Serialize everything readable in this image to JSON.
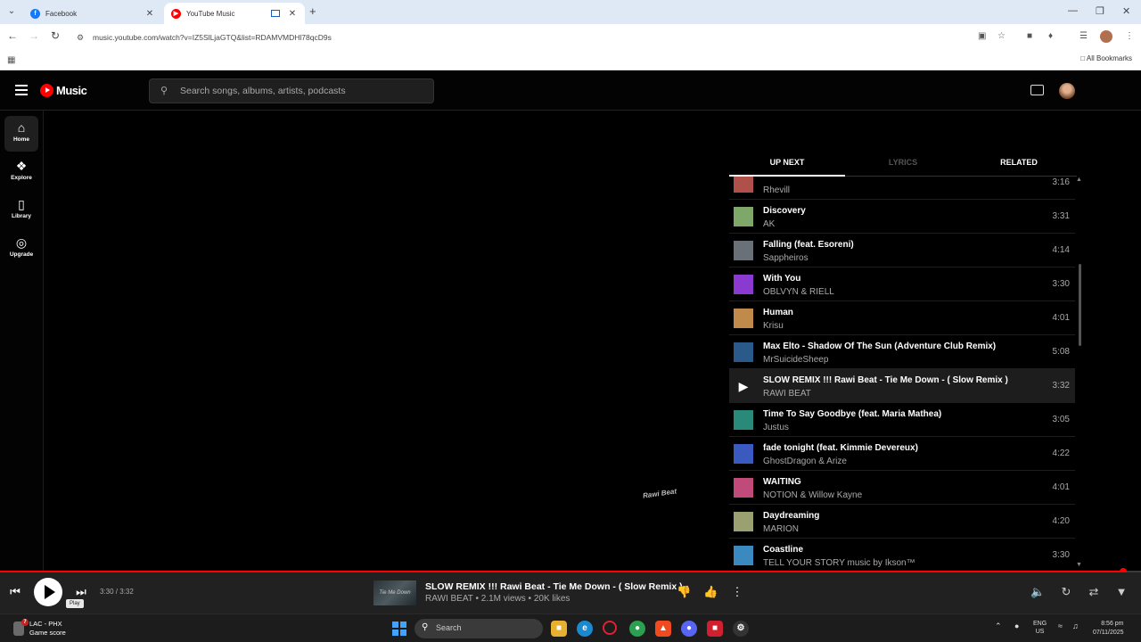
{
  "browser": {
    "tabs": [
      {
        "title": "Facebook",
        "active": false
      },
      {
        "title": "YouTube Music",
        "active": true
      }
    ],
    "url": "music.youtube.com/watch?v=IZ5SlLjaGTQ&list=RDAMVMDHl78qcD9s",
    "all_bookmarks": "All Bookmarks"
  },
  "ytm": {
    "logo": "Music",
    "search_placeholder": "Search songs, albums, artists, podcasts",
    "nav": [
      {
        "label": "Home",
        "icon": "home-icon",
        "active": true
      },
      {
        "label": "Explore",
        "icon": "explore-icon",
        "active": false
      },
      {
        "label": "Library",
        "icon": "library-icon",
        "active": false
      },
      {
        "label": "Upgrade",
        "icon": "upgrade-icon",
        "active": false
      }
    ],
    "watermark": "Rawi Beat"
  },
  "panel": {
    "tabs": [
      "UP NEXT",
      "LYRICS",
      "RELATED"
    ],
    "active_tab": "UP NEXT",
    "queue": [
      {
        "title": "",
        "artist": "Rhevill",
        "duration": "3:16",
        "color": "#b0504a",
        "playing": false
      },
      {
        "title": "Discovery",
        "artist": "AK",
        "duration": "3:31",
        "color": "#7ea86a",
        "playing": false
      },
      {
        "title": "Falling (feat. Esoreni)",
        "artist": "Sappheiros",
        "duration": "4:14",
        "color": "#6a7078",
        "playing": false
      },
      {
        "title": "With You",
        "artist": "OBLVYN & RIELL",
        "duration": "3:30",
        "color": "#8a3ad0",
        "playing": false
      },
      {
        "title": "Human",
        "artist": "Krisu",
        "duration": "4:01",
        "color": "#c08a4a",
        "playing": false
      },
      {
        "title": "Max Elto - Shadow Of The Sun (Adventure Club Remix)",
        "artist": "MrSuicideSheep",
        "duration": "5:08",
        "color": "#2a5a8a",
        "playing": false
      },
      {
        "title": "SLOW REMIX !!! Rawi Beat - Tie Me Down - ( Slow Remix )",
        "artist": "RAWI BEAT",
        "duration": "3:32",
        "color": "#1d1d1d",
        "playing": true
      },
      {
        "title": "Time To Say Goodbye (feat. Maria Mathea)",
        "artist": "Justus",
        "duration": "3:05",
        "color": "#2a8a7a",
        "playing": false
      },
      {
        "title": "fade tonight (feat. Kimmie Devereux)",
        "artist": "GhostDragon & Arize",
        "duration": "4:22",
        "color": "#3a5ac0",
        "playing": false
      },
      {
        "title": "WAITING",
        "artist": "NOTION & Willow Kayne",
        "duration": "4:01",
        "color": "#c04a7a",
        "playing": false
      },
      {
        "title": "Daydreaming",
        "artist": "MARION",
        "duration": "4:20",
        "color": "#9aa070",
        "playing": false
      },
      {
        "title": "Coastline",
        "artist": "TELL YOUR STORY music by Ikson™",
        "duration": "3:30",
        "color": "#3a8ac0",
        "playing": false
      }
    ]
  },
  "player": {
    "progress": 0.985,
    "time": "3:30 / 3:32",
    "tooltip": "Play",
    "now_playing_title": "SLOW REMIX !!! Rawi Beat - Tie Me Down - ( Slow Remix )",
    "now_playing_sub": "RAWI BEAT • 2.1M views • 20K likes",
    "thumb_text": "Tie Me Down"
  },
  "taskbar": {
    "weather_badge": "7",
    "game_line1": "LAC - PHX",
    "game_line2": "Game score",
    "search_label": "Search",
    "lang_line1": "ENG",
    "lang_line2": "US",
    "time": "8:56 pm",
    "date": "07/11/2025"
  }
}
